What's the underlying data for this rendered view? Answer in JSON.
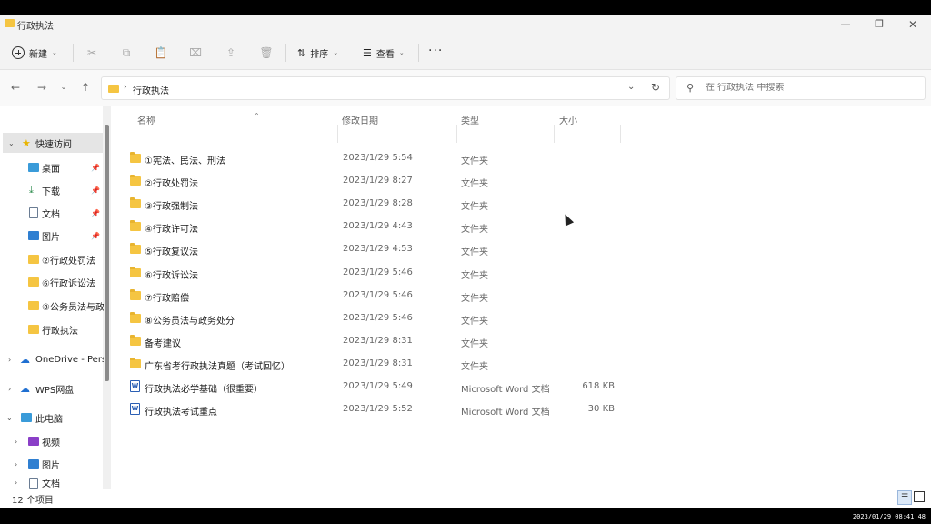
{
  "window": {
    "title": "行政执法",
    "minimize_glyph": "—",
    "restore_glyph": "❐",
    "close_glyph": "✕"
  },
  "toolbar": {
    "new_label": "新建",
    "sort_label": "排序",
    "view_label": "查看",
    "more_glyph": "···",
    "icons": [
      "cut-icon",
      "copy-icon",
      "paste-icon",
      "rename-icon",
      "share-icon",
      "delete-icon"
    ]
  },
  "address": {
    "path": "行政执法",
    "search_placeholder": "在 行政执法 中搜索"
  },
  "sidebar": {
    "quick_access": "快速访问",
    "items": [
      {
        "label": "桌面",
        "icon": "desktop-icon",
        "pinned": true
      },
      {
        "label": "下载",
        "icon": "download-icon",
        "pinned": true
      },
      {
        "label": "文档",
        "icon": "document-icon",
        "pinned": true
      },
      {
        "label": "图片",
        "icon": "picture-icon",
        "pinned": true
      },
      {
        "label": "②行政处罚法",
        "icon": "folder-icon",
        "pinned": false
      },
      {
        "label": "⑥行政诉讼法",
        "icon": "folder-icon",
        "pinned": false
      },
      {
        "label": "⑧公务员法与政",
        "icon": "folder-icon",
        "pinned": false
      },
      {
        "label": "行政执法",
        "icon": "folder-icon",
        "pinned": false
      }
    ],
    "onedrive": "OneDrive - Pers",
    "wps": "WPS网盘",
    "this_pc": "此电脑",
    "pc_items": [
      {
        "label": "视频",
        "icon": "video-icon"
      },
      {
        "label": "图片",
        "icon": "picture-icon"
      },
      {
        "label": "文档",
        "icon": "document-icon"
      }
    ]
  },
  "columns": {
    "name": "名称",
    "date": "修改日期",
    "type": "类型",
    "size": "大小"
  },
  "files": [
    {
      "name": "①宪法、民法、刑法",
      "date": "2023/1/29 5:54",
      "type": "文件夹",
      "size": "",
      "kind": "folder"
    },
    {
      "name": "②行政处罚法",
      "date": "2023/1/29 8:27",
      "type": "文件夹",
      "size": "",
      "kind": "folder"
    },
    {
      "name": "③行政强制法",
      "date": "2023/1/29 8:28",
      "type": "文件夹",
      "size": "",
      "kind": "folder"
    },
    {
      "name": "④行政许可法",
      "date": "2023/1/29 4:43",
      "type": "文件夹",
      "size": "",
      "kind": "folder"
    },
    {
      "name": "⑤行政复议法",
      "date": "2023/1/29 4:53",
      "type": "文件夹",
      "size": "",
      "kind": "folder"
    },
    {
      "name": "⑥行政诉讼法",
      "date": "2023/1/29 5:46",
      "type": "文件夹",
      "size": "",
      "kind": "folder"
    },
    {
      "name": "⑦行政赔偿",
      "date": "2023/1/29 5:46",
      "type": "文件夹",
      "size": "",
      "kind": "folder"
    },
    {
      "name": "⑧公务员法与政务处分",
      "date": "2023/1/29 5:46",
      "type": "文件夹",
      "size": "",
      "kind": "folder"
    },
    {
      "name": "备考建议",
      "date": "2023/1/29 8:31",
      "type": "文件夹",
      "size": "",
      "kind": "folder"
    },
    {
      "name": "广东省考行政执法真题（考试回忆）",
      "date": "2023/1/29 8:31",
      "type": "文件夹",
      "size": "",
      "kind": "folder"
    },
    {
      "name": "行政执法必学基础（很重要）",
      "date": "2023/1/29 5:49",
      "type": "Microsoft Word 文档",
      "size": "618 KB",
      "kind": "word"
    },
    {
      "name": "行政执法考试重点",
      "date": "2023/1/29 5:52",
      "type": "Microsoft Word 文档",
      "size": "30 KB",
      "kind": "word"
    }
  ],
  "status": {
    "count": "12 个项目"
  },
  "overlay": {
    "timestamp": "2023/01/29 08:41:48"
  },
  "colors": {
    "folder": "#f5c542",
    "selected": "#e5e5e5",
    "word_blue": "#2b5fb4"
  }
}
